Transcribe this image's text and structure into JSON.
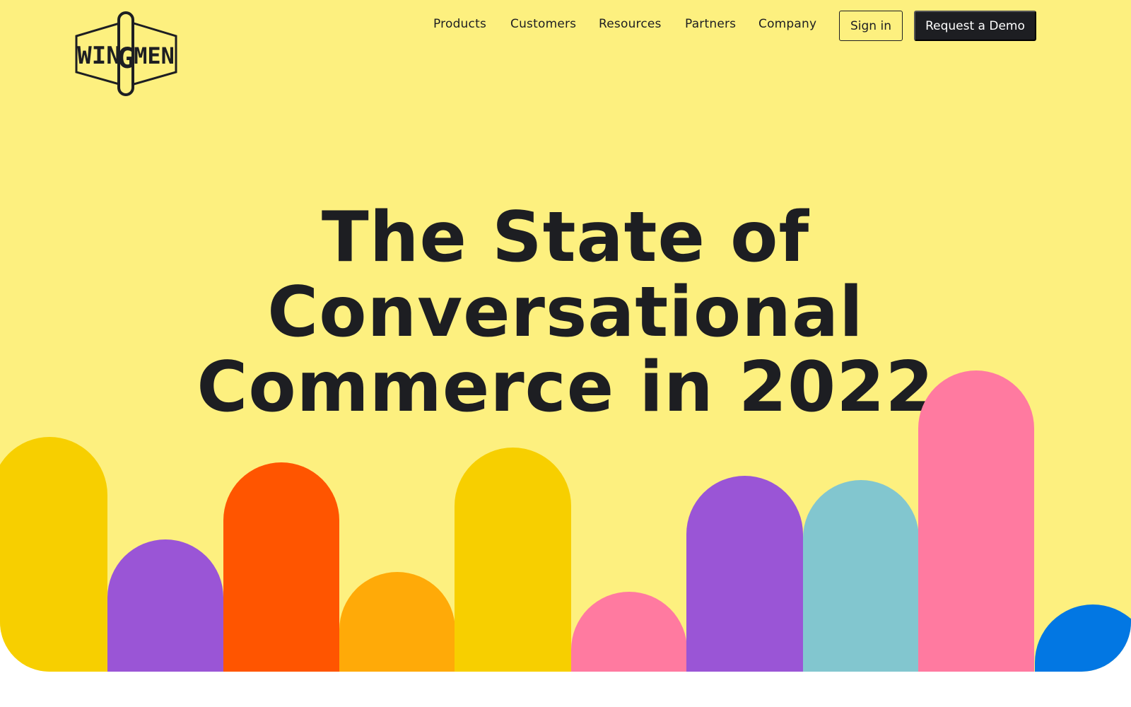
{
  "brand": {
    "logo_alt": "WINGMEN",
    "hero_background": "#fdf07f"
  },
  "nav": {
    "links": [
      "Products",
      "Customers",
      "Resources",
      "Partners",
      "Company"
    ],
    "sign_in": "Sign in",
    "cta": "Request a Demo"
  },
  "hero": {
    "headline_lines": [
      "The State of",
      "Conversational",
      "Commerce in 2022"
    ]
  },
  "decor": {
    "pill_colors": [
      "#f7cf00",
      "#9a55d6",
      "#ff5500",
      "#ffaa08",
      "#f7cf00",
      "#ff7aa0",
      "#9a55d6",
      "#82c6cf",
      "#ff7aa0",
      "#0277e3"
    ]
  }
}
